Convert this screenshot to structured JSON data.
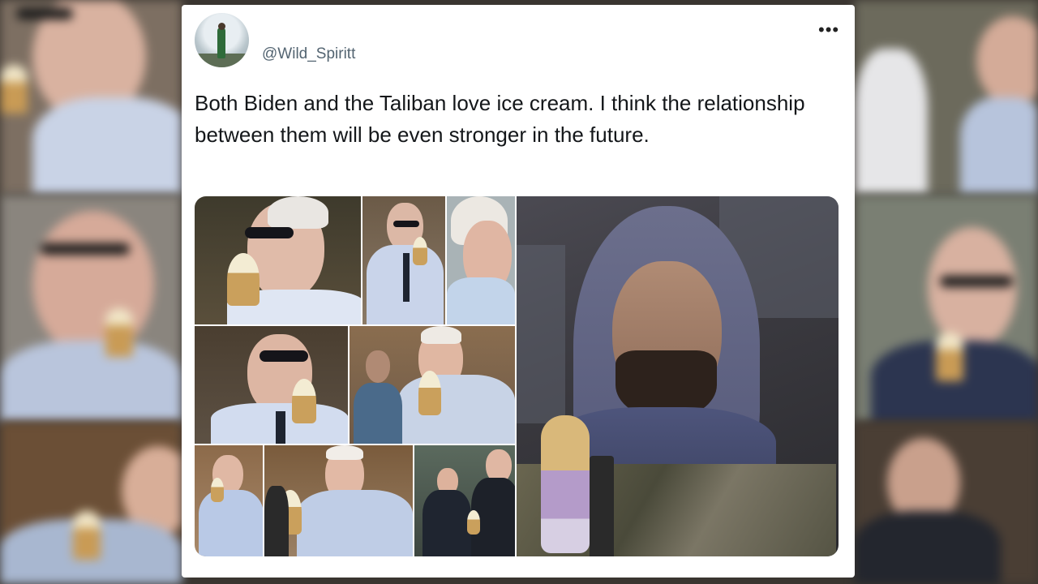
{
  "tweet": {
    "handle": "@Wild_Spiritt",
    "more_label": "•••",
    "text": "Both Biden and the Taliban love ice cream. I think the relationship between them will be even stronger in the future."
  },
  "media": {
    "photo_count": 8
  },
  "colors": {
    "card_bg": "#ffffff",
    "text": "#14171a",
    "handle": "#536471"
  }
}
